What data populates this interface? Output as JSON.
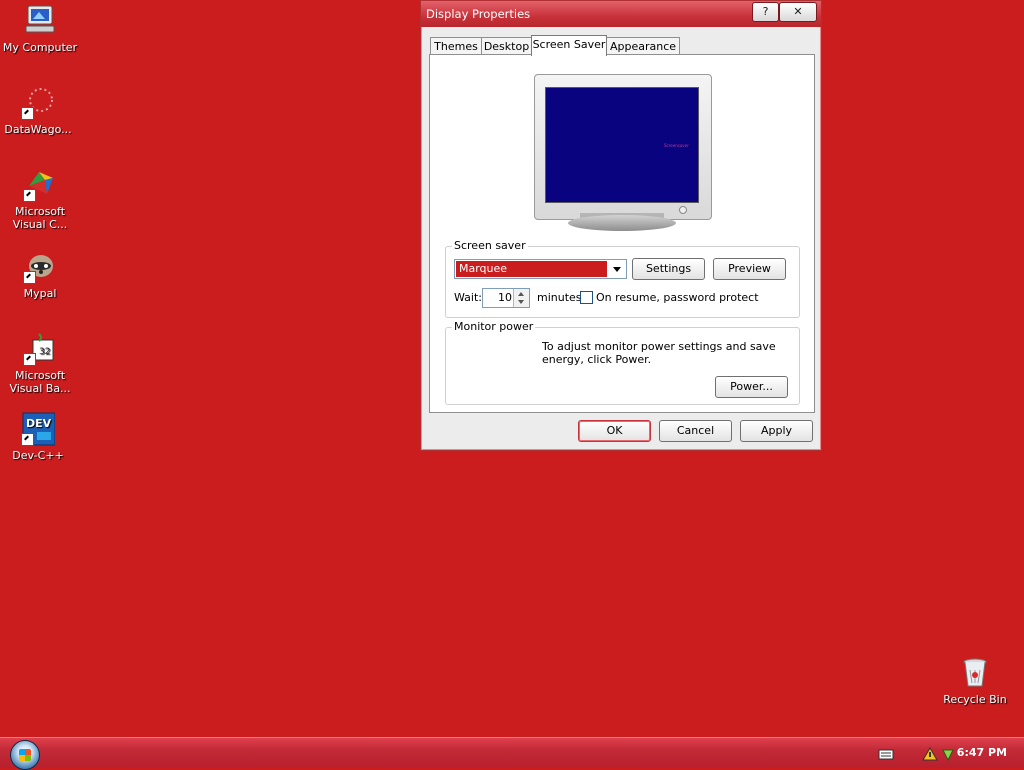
{
  "desktop": {
    "icons": [
      {
        "name": "my-computer",
        "label": "My Computer"
      },
      {
        "name": "datawagon",
        "label": "DataWago..."
      },
      {
        "name": "ms-visual-c",
        "label": "Microsoft Visual C..."
      },
      {
        "name": "mypal",
        "label": "Mypal"
      },
      {
        "name": "ms-visual-basic",
        "label": "Microsoft Visual Ba..."
      },
      {
        "name": "dev-cpp",
        "label": "Dev-C++"
      },
      {
        "name": "recycle-bin",
        "label": "Recycle Bin"
      }
    ],
    "background_color": "#cb1c1e"
  },
  "dialog": {
    "title": "Display Properties",
    "help_btn": "?",
    "close_btn": "✕",
    "tabs": [
      "Themes",
      "Desktop",
      "Screen Saver",
      "Appearance"
    ],
    "active_tab": "Screen Saver",
    "preview": {
      "marquee_text": "Screensaver"
    },
    "screen_saver": {
      "legend": "Screen saver",
      "selected": "Marquee",
      "settings_btn": "Settings",
      "preview_btn": "Preview",
      "wait_label": "Wait:",
      "wait_value": "10",
      "minutes_label": "minutes",
      "password_label": "On resume, password protect",
      "password_checked": false
    },
    "monitor_power": {
      "legend": "Monitor power",
      "description": "To adjust monitor power settings and save energy, click Power.",
      "power_btn": "Power..."
    },
    "buttons": {
      "ok": "OK",
      "cancel": "Cancel",
      "apply": "Apply"
    }
  },
  "taskbar": {
    "clock": "6:47 PM",
    "tray_icons": [
      "keyboard-icon",
      "network-icon",
      "security-icon"
    ]
  }
}
